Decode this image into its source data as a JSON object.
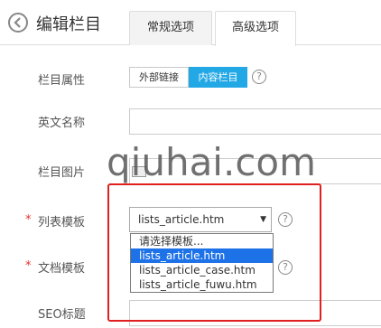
{
  "header": {
    "title": "编辑栏目",
    "back_icon": "back-arrow-icon"
  },
  "tabs": [
    {
      "label": "常规选项",
      "active": false
    },
    {
      "label": "高级选项",
      "active": true
    }
  ],
  "form": {
    "attribute": {
      "label": "栏目属性",
      "options": [
        "外部链接",
        "内容栏目"
      ],
      "selected": "内容栏目",
      "help": "?"
    },
    "english_name": {
      "label": "英文名称",
      "value": ""
    },
    "image": {
      "label": "栏目图片"
    },
    "list_template": {
      "label": "列表模板",
      "required_mark": "*",
      "value": "lists_article.htm",
      "help": "?",
      "options": [
        "请选择模板...",
        "lists_article.htm",
        "lists_article_case.htm",
        "lists_article_fuwu.htm"
      ],
      "highlighted": "lists_article.htm"
    },
    "doc_template": {
      "label": "文档模板",
      "required_mark": "*",
      "help": "?"
    },
    "seo_title": {
      "label": "SEO标题"
    }
  },
  "watermark": "qiuhai.com",
  "colors": {
    "accent": "#23a8e6",
    "selection": "#1e72e8",
    "required": "#e62e2e",
    "highlight_box": "#e02020"
  }
}
